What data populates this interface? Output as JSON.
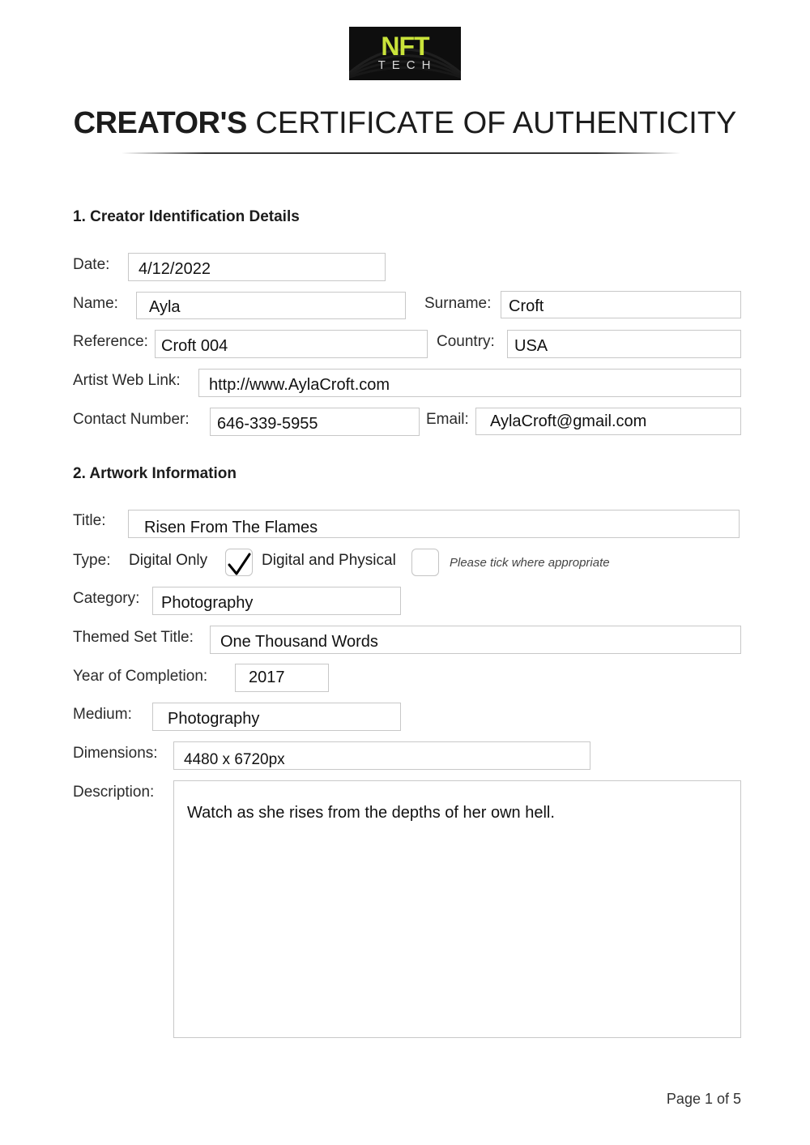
{
  "logo": {
    "brand_top": "NFT",
    "brand_bottom": "TECH",
    "accent_color": "#c9e33a",
    "background_color": "#0e0e0e"
  },
  "title": {
    "bold_part": "CREATOR'S",
    "light_part": "CERTIFICATE OF AUTHENTICITY"
  },
  "section1": {
    "heading": "1. Creator Identification Details",
    "date": {
      "label": "Date:",
      "value": "4/12/2022"
    },
    "name": {
      "label": "Name:",
      "value": "Ayla"
    },
    "surname": {
      "label": "Surname:",
      "value": "Croft"
    },
    "reference": {
      "label": "Reference:",
      "value": "Croft 004"
    },
    "country": {
      "label": "Country:",
      "value": "USA"
    },
    "web_link": {
      "label": "Artist Web Link:",
      "value": "http://www.AylaCroft.com"
    },
    "contact_number": {
      "label": "Contact Number:",
      "value": "646-339-5955"
    },
    "email": {
      "label": "Email:",
      "value": "AylaCroft@gmail.com"
    }
  },
  "section2": {
    "heading": "2. Artwork Information",
    "title": {
      "label": "Title:",
      "value": "Risen From The Flames"
    },
    "type": {
      "label": "Type:",
      "options": [
        {
          "label": "Digital Only",
          "checked": true
        },
        {
          "label": "Digital and Physical",
          "checked": false
        }
      ],
      "hint": "Please tick where appropriate"
    },
    "category": {
      "label": "Category:",
      "value": "Photography"
    },
    "themed_set_title": {
      "label": "Themed Set Title:",
      "value": "One Thousand Words"
    },
    "year_of_completion": {
      "label": "Year of Completion:",
      "value": "2017"
    },
    "medium": {
      "label": "Medium:",
      "value": "Photography"
    },
    "dimensions": {
      "label": "Dimensions:",
      "value": "4480 x 6720px"
    },
    "description": {
      "label": "Description:",
      "value": "Watch as she rises from the depths of her own hell."
    }
  },
  "footer": {
    "page_indicator": "Page 1 of 5"
  }
}
